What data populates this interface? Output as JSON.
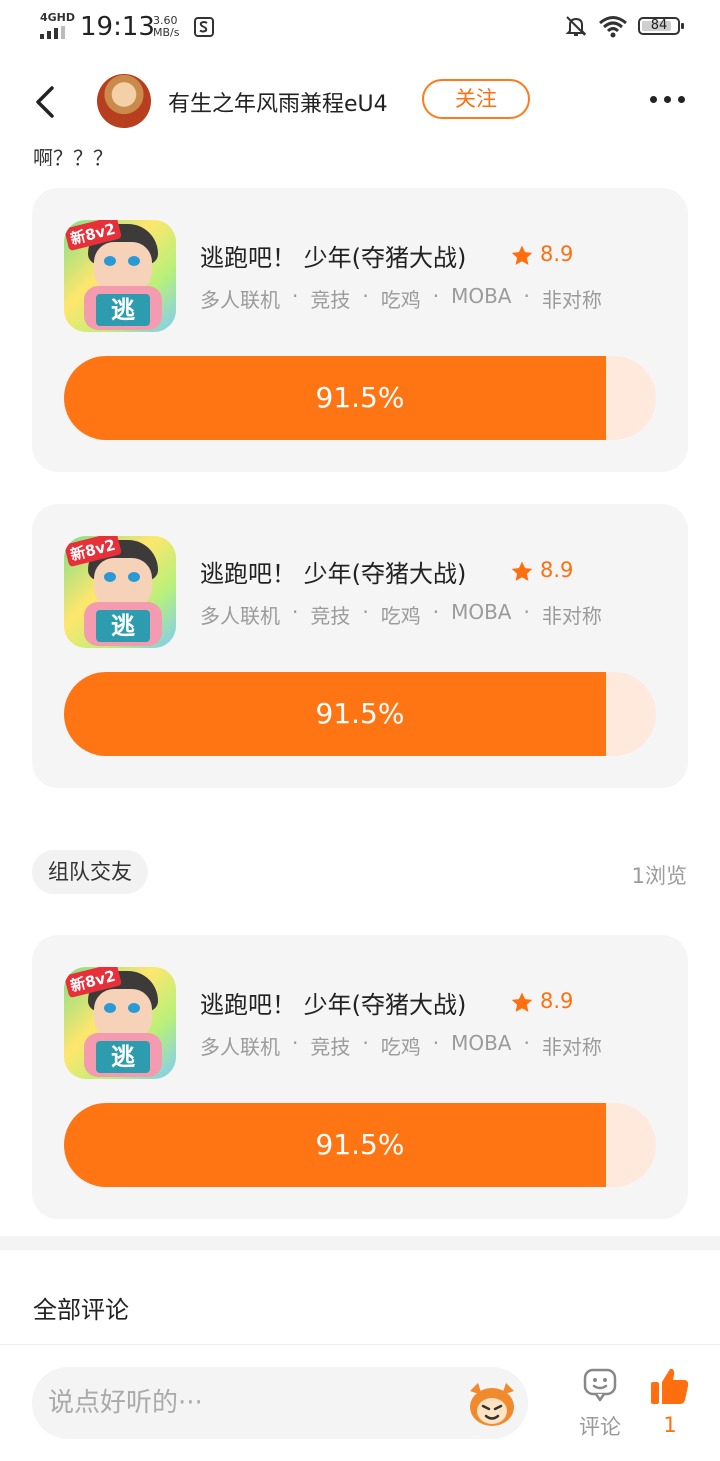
{
  "status_bar": {
    "network": "4GHD",
    "time": "19:13",
    "speed_value": "3.60",
    "speed_unit": "MB/s",
    "battery": "84",
    "battery_level": 0.84
  },
  "header": {
    "username": "有生之年风雨兼程eU4",
    "follow_label": "关注"
  },
  "post": {
    "text_fragment": "啊？？？"
  },
  "game_cards": [
    {
      "title": "逃跑吧！ 少年(夺猪大战)",
      "rating": "8.9",
      "icon_badge": "新8v2",
      "icon_sign": "逃",
      "tags": [
        "多人联机",
        "竞技",
        "吃鸡",
        "MOBA",
        "非对称"
      ],
      "percent_label": "91.5%",
      "percent": 91.5
    },
    {
      "title": "逃跑吧！ 少年(夺猪大战)",
      "rating": "8.9",
      "icon_badge": "新8v2",
      "icon_sign": "逃",
      "tags": [
        "多人联机",
        "竞技",
        "吃鸡",
        "MOBA",
        "非对称"
      ],
      "percent_label": "91.5%",
      "percent": 91.5
    },
    {
      "title": "逃跑吧！ 少年(夺猪大战)",
      "rating": "8.9",
      "icon_badge": "新8v2",
      "icon_sign": "逃",
      "tags": [
        "多人联机",
        "竞技",
        "吃鸡",
        "MOBA",
        "非对称"
      ],
      "percent_label": "91.5%",
      "percent": 91.5
    }
  ],
  "topic_tag": "组队交友",
  "views": "1浏览",
  "comments_title": "全部评论",
  "bottom_bar": {
    "input_placeholder": "说点好听的···",
    "comment_label": "评论",
    "like_count": "1"
  },
  "colors": {
    "accent": "#ff7514",
    "progress_track": "#ffe9dd",
    "card_bg": "#f5f5f5"
  },
  "icons": {
    "back": "back-arrow-icon",
    "more": "more-dots-icon",
    "star": "star-icon",
    "comment": "comment-bubble-icon",
    "like": "thumbs-up-icon",
    "mascot": "mascot-icon"
  }
}
